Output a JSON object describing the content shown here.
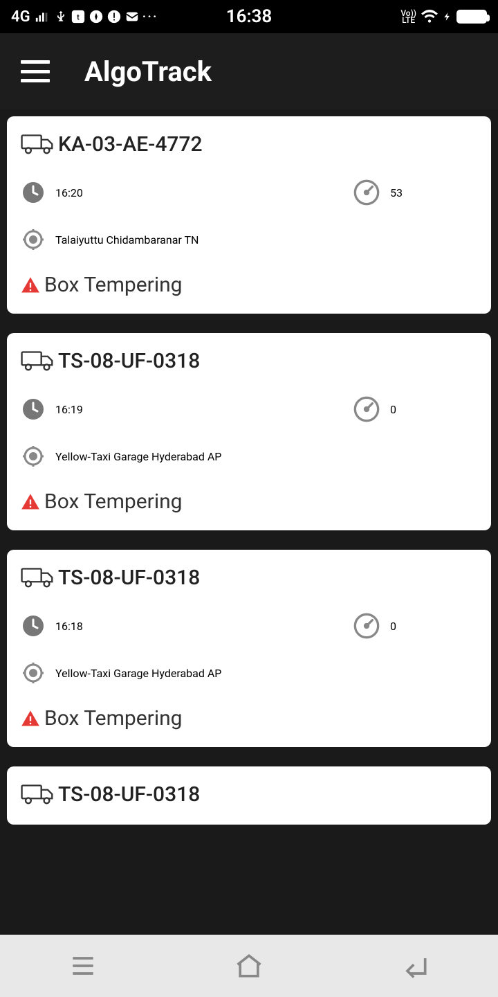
{
  "status_bar": {
    "network": "4G",
    "time": "16:38",
    "lte_label": "Vo))\nLTE"
  },
  "app": {
    "title": "AlgoTrack"
  },
  "vehicles": [
    {
      "plate": "KA-03-AE-4772",
      "time": "16:20",
      "speed": "53",
      "location": "Talaiyuttu Chidambaranar TN",
      "alert": "Box Tempering"
    },
    {
      "plate": "TS-08-UF-0318",
      "time": "16:19",
      "speed": "0",
      "location": "Yellow-Taxi Garage Hyderabad AP",
      "alert": "Box Tempering"
    },
    {
      "plate": "TS-08-UF-0318",
      "time": "16:18",
      "speed": "0",
      "location": "Yellow-Taxi Garage Hyderabad AP",
      "alert": "Box Tempering"
    },
    {
      "plate": "TS-08-UF-0318",
      "time": "",
      "speed": "",
      "location": "",
      "alert": ""
    }
  ]
}
